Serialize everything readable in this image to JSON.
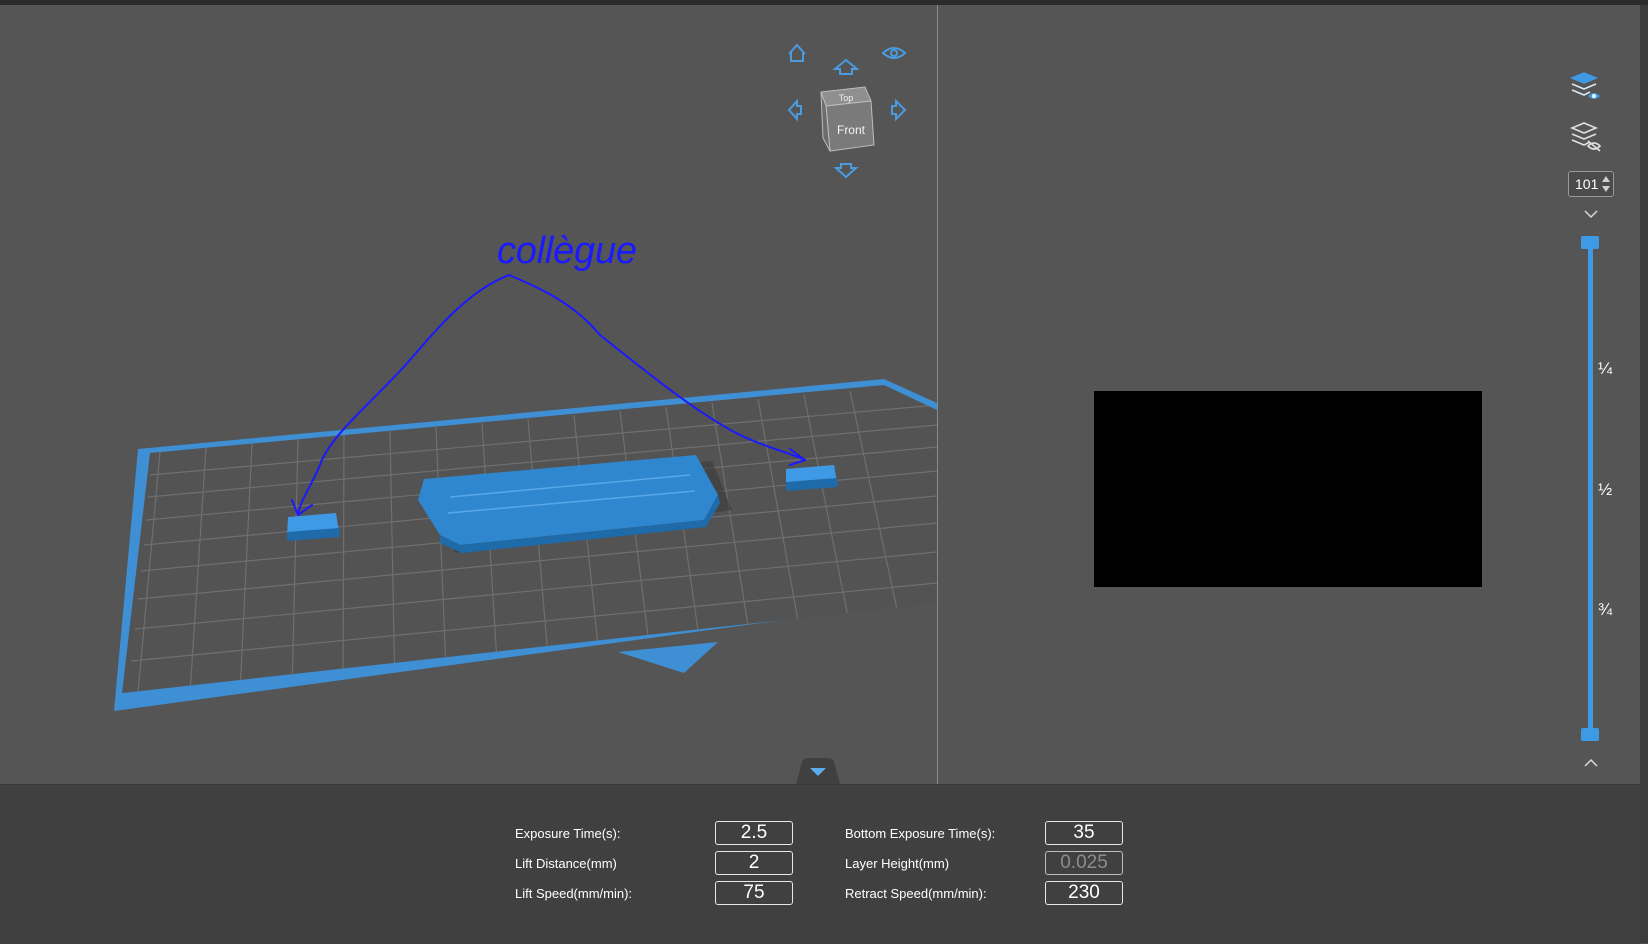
{
  "viewport": {
    "annotation_text": "collègue",
    "view_cube": {
      "top_label": "Top",
      "front_label": "Front"
    },
    "icons": [
      "home-icon",
      "eye-icon",
      "arrow-up-icon",
      "arrow-left-icon",
      "arrow-right-icon",
      "arrow-down-icon"
    ]
  },
  "layer_controls": {
    "layer_number": "101",
    "fractions": [
      "¼",
      "½",
      "¾"
    ],
    "icons": [
      "show-layers-icon",
      "hide-layers-icon",
      "chevron-down-icon",
      "chevron-up-icon"
    ],
    "slider_position": 0
  },
  "parameters": {
    "exposure_time_label": "Exposure Time(s):",
    "exposure_time_value": "2.5",
    "lift_distance_label": "Lift Distance(mm)",
    "lift_distance_value": "2",
    "lift_speed_label": "Lift Speed(mm/min):",
    "lift_speed_value": "75",
    "bottom_exposure_label": "Bottom Exposure Time(s):",
    "bottom_exposure_value": "35",
    "layer_height_label": "Layer Height(mm)",
    "layer_height_value": "0.025",
    "retract_speed_label": "Retract Speed(mm/min):",
    "retract_speed_value": "230"
  },
  "colors": {
    "accent": "#3f9ae6",
    "annotation": "#1a1aff",
    "viewport_bg": "#555555",
    "panel_bg": "#404040"
  }
}
